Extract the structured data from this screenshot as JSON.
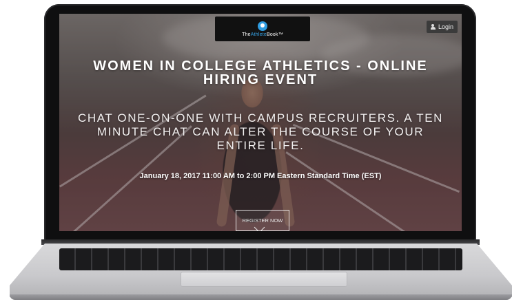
{
  "header": {
    "logo": {
      "text_prefix": "The",
      "text_accent": "Athlete",
      "text_suffix": "Book™"
    },
    "login_label": "Login"
  },
  "hero": {
    "title": "WOMEN IN COLLEGE ATHLETICS - ONLINE HIRING EVENT",
    "tagline": "CHAT ONE-ON-ONE WITH CAMPUS RECRUITERS. A TEN MINUTE CHAT CAN ALTER THE COURSE OF YOUR ENTIRE LIFE.",
    "date": "January 18, 2017 11:00 AM to 2:00 PM Eastern Standard Time (EST)",
    "register_label": "REGISTER NOW"
  },
  "icons": {
    "logo": "athlete-book-logo-icon",
    "login": "user-icon",
    "scroll": "chevron-down-icon"
  },
  "colors": {
    "logo_accent": "#36a3e6",
    "logo_bg": "#111111",
    "login_bg": "#3b3b3b"
  }
}
